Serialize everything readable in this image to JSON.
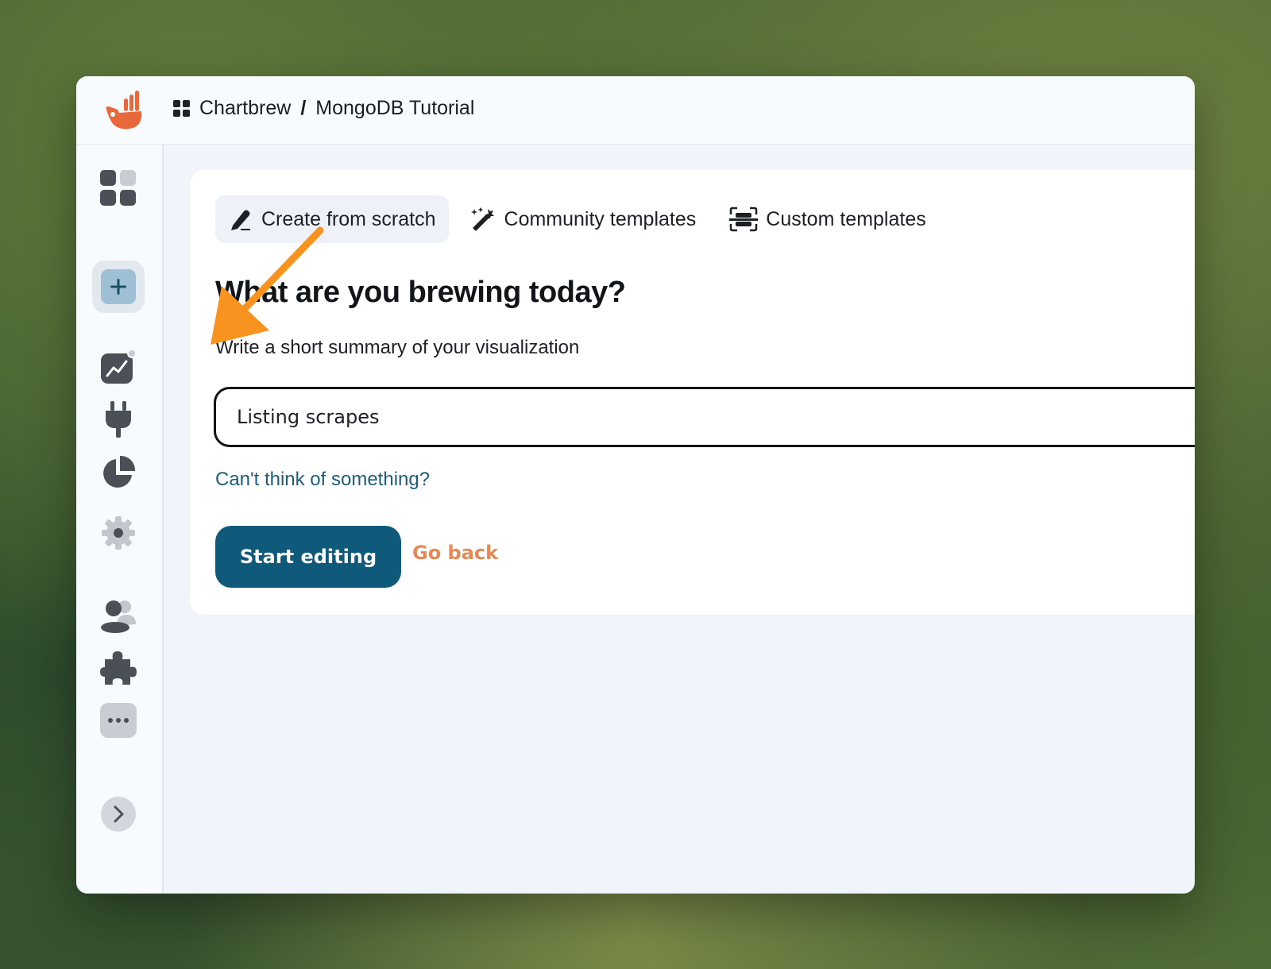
{
  "header": {
    "workspace": "Chartbrew",
    "separator": "/",
    "project": "MongoDB Tutorial"
  },
  "sidebar": {
    "items": [
      {
        "icon": "dashboard-grid-icon"
      },
      {
        "icon": "plus-icon",
        "active": true
      },
      {
        "icon": "chart-icon"
      },
      {
        "icon": "plug-icon"
      },
      {
        "icon": "pie-chart-icon"
      },
      {
        "icon": "gear-icon"
      },
      {
        "icon": "users-icon"
      },
      {
        "icon": "puzzle-icon"
      },
      {
        "icon": "more-icon"
      },
      {
        "icon": "chevron-right-icon"
      }
    ]
  },
  "tabs": [
    {
      "label": "Create from scratch",
      "icon": "pencil-icon",
      "active": true
    },
    {
      "label": "Community templates",
      "icon": "magic-wand-icon",
      "active": false
    },
    {
      "label": "Custom templates",
      "icon": "template-icon",
      "active": false
    }
  ],
  "main": {
    "heading": "What are you brewing today?",
    "subtitle": "Write a short summary of your visualization",
    "input_value": "Listing scrapes",
    "suggestion_link": "Can't think of something?",
    "start_button": "Start editing",
    "back_link": "Go back"
  },
  "colors": {
    "primary": "#0f5a7a",
    "accent": "#e58a57",
    "link": "#1d5d7a",
    "annotation_arrow": "#f7931e"
  }
}
